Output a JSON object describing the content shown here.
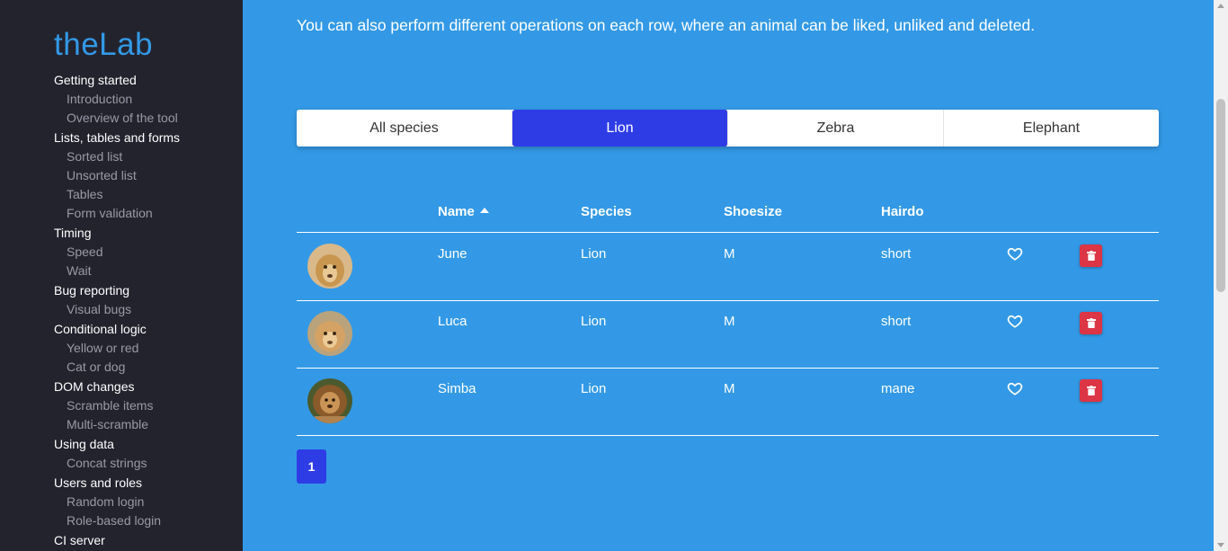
{
  "sidebar": {
    "logo": "theLab",
    "groups": [
      {
        "label": "Getting started",
        "items": [
          "Introduction",
          "Overview of the tool"
        ]
      },
      {
        "label": "Lists, tables and forms",
        "items": [
          "Sorted list",
          "Unsorted list",
          "Tables",
          "Form validation"
        ]
      },
      {
        "label": "Timing",
        "items": [
          "Speed",
          "Wait"
        ]
      },
      {
        "label": "Bug reporting",
        "items": [
          "Visual bugs"
        ]
      },
      {
        "label": "Conditional logic",
        "items": [
          "Yellow or red",
          "Cat or dog"
        ]
      },
      {
        "label": "DOM changes",
        "items": [
          "Scramble items",
          "Multi-scramble"
        ]
      },
      {
        "label": "Using data",
        "items": [
          "Concat strings"
        ]
      },
      {
        "label": "Users and roles",
        "items": [
          "Random login",
          "Role-based login"
        ]
      },
      {
        "label": "CI server",
        "items": []
      }
    ]
  },
  "main": {
    "intro": "You can also perform different operations on each row, where an animal can be liked, unliked and deleted.",
    "tabs": [
      {
        "label": "All species",
        "active": false
      },
      {
        "label": "Lion",
        "active": true
      },
      {
        "label": "Zebra",
        "active": false
      },
      {
        "label": "Elephant",
        "active": false
      }
    ],
    "table": {
      "headers": {
        "name": "Name",
        "species": "Species",
        "shoesize": "Shoesize",
        "hairdo": "Hairdo"
      },
      "rows": [
        {
          "name": "June",
          "species": "Lion",
          "shoesize": "M",
          "hairdo": "short"
        },
        {
          "name": "Luca",
          "species": "Lion",
          "shoesize": "M",
          "hairdo": "short"
        },
        {
          "name": "Simba",
          "species": "Lion",
          "shoesize": "M",
          "hairdo": "mane"
        }
      ]
    },
    "pagination": {
      "current": "1"
    }
  },
  "colors": {
    "background": "#3399e6",
    "sidebar": "#23232e",
    "accent": "#2e3ce6",
    "delete": "#dc3545"
  },
  "icons": {
    "sort": "sort-ascending-icon",
    "like": "heart-outline-icon",
    "delete": "trash-icon"
  }
}
